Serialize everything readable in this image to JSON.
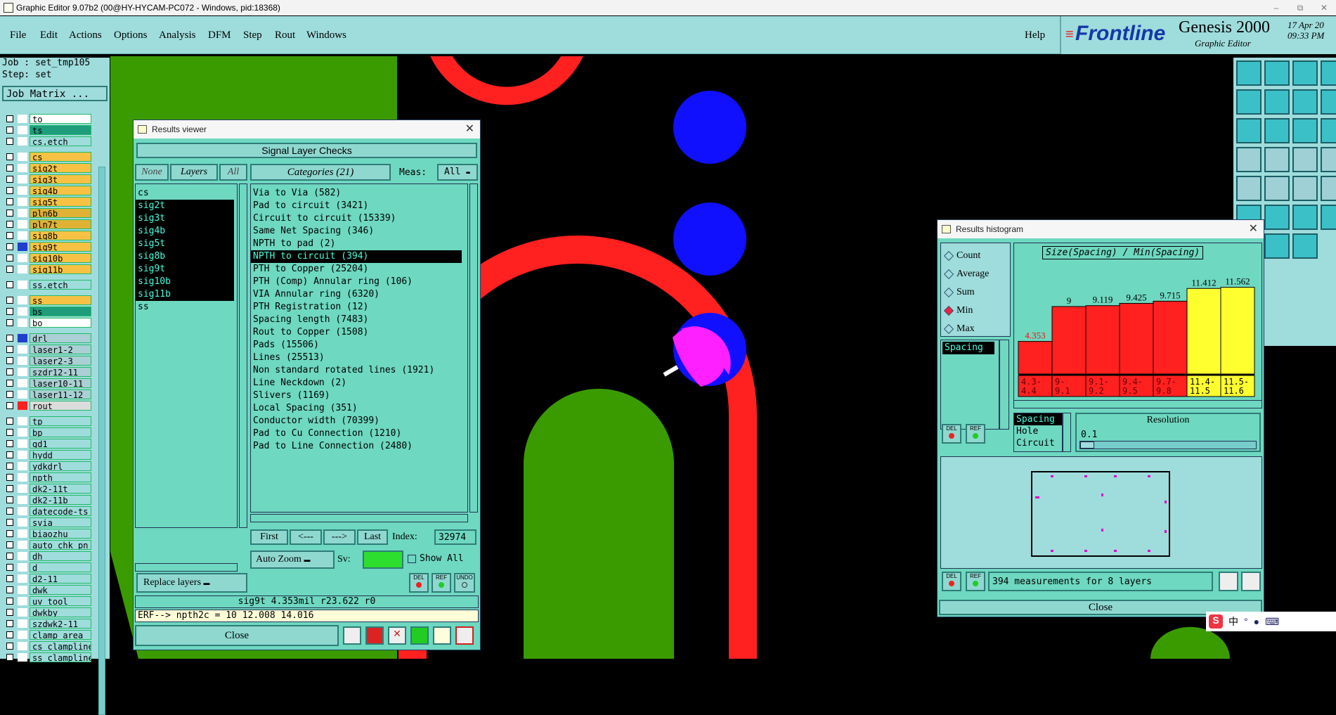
{
  "window": {
    "title": "Graphic Editor 9.07b2 (00@HY-HYCAM-PC072 - Windows, pid:18368)",
    "controls": [
      "–",
      "⧉",
      "✕"
    ]
  },
  "menu": {
    "items": [
      "File",
      "Edit",
      "Actions",
      "Options",
      "Analysis",
      "DFM",
      "Step",
      "Rout",
      "Windows"
    ],
    "help": "Help"
  },
  "logo": {
    "brand": "Frontline",
    "product": "Genesis 2000",
    "sub": "Graphic Editor",
    "date": "17 Apr 20",
    "time": "09:33 PM"
  },
  "job": {
    "job": "Job : set_tmp105",
    "step": "Step: set",
    "matrix": "Job Matrix ..."
  },
  "layers": [
    {
      "name": "to",
      "color": "#ffffff",
      "box": "#ffffff"
    },
    {
      "name": "ts",
      "color": "#1e9c7c",
      "box": "#ffffff"
    },
    {
      "name": "cs.etch",
      "color": "#9fdcdc",
      "box": "#ffffff"
    },
    {
      "name": "cs",
      "color": "#f7c244",
      "box": "#ffffff"
    },
    {
      "name": "sig2t",
      "color": "#f7c244",
      "box": "#ffffff"
    },
    {
      "name": "sig3t",
      "color": "#f7c244",
      "box": "#ffffff"
    },
    {
      "name": "sig4b",
      "color": "#f7c244",
      "box": "#ffffff"
    },
    {
      "name": "sig5t",
      "color": "#f7c244",
      "box": "#ffffff"
    },
    {
      "name": "pln6b",
      "color": "#dfb235",
      "box": "#ffffff"
    },
    {
      "name": "pln7t",
      "color": "#dfb235",
      "box": "#ffffff"
    },
    {
      "name": "sig8b",
      "color": "#f7c244",
      "box": "#ffffff"
    },
    {
      "name": "sig9t",
      "color": "#f7c244",
      "box": "#1f3fcc"
    },
    {
      "name": "sig10b",
      "color": "#f7c244",
      "box": "#ffffff"
    },
    {
      "name": "sig11b",
      "color": "#f7c244",
      "box": "#ffffff"
    },
    {
      "name": "ss.etch",
      "color": "#9fdcdc",
      "box": "#ffffff"
    },
    {
      "name": "ss",
      "color": "#f7c244",
      "box": "#ffffff"
    },
    {
      "name": "bs",
      "color": "#1e9c7c",
      "box": "#ffffff"
    },
    {
      "name": "bo",
      "color": "#ffffff",
      "box": "#ffffff"
    },
    {
      "name": "drl",
      "color": "#aacfd4",
      "box": "#1f3fcc"
    },
    {
      "name": "laser1-2",
      "color": "#aacfd4",
      "box": "#ffffff"
    },
    {
      "name": "laser2-3",
      "color": "#aacfd4",
      "box": "#ffffff"
    },
    {
      "name": "szdr12-11",
      "color": "#aacfd4",
      "box": "#ffffff"
    },
    {
      "name": "laser10-11",
      "color": "#aacfd4",
      "box": "#ffffff"
    },
    {
      "name": "laser11-12",
      "color": "#aacfd4",
      "box": "#ffffff"
    },
    {
      "name": "rout",
      "color": "#dcdcdc",
      "box": "#ff2020"
    },
    {
      "name": "tp",
      "color": "#9fdcdc",
      "box": "#ffffff"
    },
    {
      "name": "bp",
      "color": "#9fdcdc",
      "box": "#ffffff"
    },
    {
      "name": "gd1",
      "color": "#9fdcdc",
      "box": "#ffffff"
    },
    {
      "name": "hydd",
      "color": "#9fdcdc",
      "box": "#ffffff"
    },
    {
      "name": "ydkdrl",
      "color": "#9fdcdc",
      "box": "#ffffff"
    },
    {
      "name": "npth",
      "color": "#9fdcdc",
      "box": "#ffffff"
    },
    {
      "name": "dk2-11t",
      "color": "#9fdcdc",
      "box": "#ffffff"
    },
    {
      "name": "dk2-11b",
      "color": "#9fdcdc",
      "box": "#ffffff"
    },
    {
      "name": "datecode-ts",
      "color": "#9fdcdc",
      "box": "#ffffff"
    },
    {
      "name": "svia",
      "color": "#9fdcdc",
      "box": "#ffffff"
    },
    {
      "name": "biaozhu",
      "color": "#9fdcdc",
      "box": "#ffffff"
    },
    {
      "name": "auto_chk_pn",
      "color": "#9fdcdc",
      "box": "#ffffff"
    },
    {
      "name": "dh",
      "color": "#9fdcdc",
      "box": "#ffffff"
    },
    {
      "name": "d",
      "color": "#9fdcdc",
      "box": "#ffffff"
    },
    {
      "name": "d2-11",
      "color": "#9fdcdc",
      "box": "#ffffff"
    },
    {
      "name": "dwk",
      "color": "#9fdcdc",
      "box": "#ffffff"
    },
    {
      "name": "uv_tool",
      "color": "#9fdcdc",
      "box": "#ffffff"
    },
    {
      "name": "dwkby",
      "color": "#9fdcdc",
      "box": "#ffffff"
    },
    {
      "name": "szdwk2-11",
      "color": "#9fdcdc",
      "box": "#ffffff"
    },
    {
      "name": "clamp_area",
      "color": "#9fdcdc",
      "box": "#ffffff"
    },
    {
      "name": "cs_clampline",
      "color": "#9fdcdc",
      "box": "#ffffff"
    },
    {
      "name": "ss_clampline",
      "color": "#9fdcdc",
      "box": "#ffffff"
    }
  ],
  "results_viewer": {
    "title": "Results viewer",
    "header": "Signal Layer Checks",
    "none": "None",
    "layers_label": "Layers",
    "all": "All",
    "layer_list": [
      "cs",
      "sig2t",
      "sig3t",
      "sig4b",
      "sig5t",
      "sig8b",
      "sig9t",
      "sig10b",
      "sig11b",
      "ss"
    ],
    "selected_layers": [
      "sig2t",
      "sig3t",
      "sig4b",
      "sig5t",
      "sig8b",
      "sig9t",
      "sig10b",
      "sig11b"
    ],
    "categories_label": "Categories (21)",
    "meas_label": "Meas:",
    "meas_value": "All",
    "categories": [
      "Via to Via (582)",
      "Pad to circuit (3421)",
      "Circuit to circuit (15339)",
      "Same Net Spacing (346)",
      "NPTH to pad (2)",
      "NPTH to circuit (394)",
      "PTH to Copper (25204)",
      "PTH (Comp) Annular ring (106)",
      "VIA Annular ring (6320)",
      "PTH Registration (12)",
      "Spacing length (7483)",
      "Rout to Copper (1508)",
      "Pads (15506)",
      "Lines (25513)",
      "Non standard rotated lines (1921)",
      "Line Neckdown (2)",
      "Slivers (1169)",
      "Local Spacing (351)",
      "Conductor width (70399)",
      "Pad to Cu Connection (1210)",
      "Pad to Line Connection (2480)"
    ],
    "selected_category": "NPTH to circuit (394)",
    "first": "First",
    "prev": "<---",
    "next": "--->",
    "last": "Last",
    "index_label": "Index:",
    "index_value": "32974",
    "auto_zoom": "Auto Zoom",
    "sv": "Sv:",
    "show_all": "Show All",
    "replace_layers": "Replace layers",
    "del": "DEL",
    "ref": "REF",
    "undo": "UNDO",
    "info": "sig9t  4.353mil  r23.622  r0",
    "erf": "ERF--> npth2c = 10 12.008 14.016",
    "close": "Close"
  },
  "histogram": {
    "title": "Results histogram",
    "modes": [
      "Count",
      "Average",
      "Sum",
      "Min",
      "Max"
    ],
    "selected_mode": "Min",
    "list_item": "Spacing",
    "chart_title": "Size(Spacing) / Min(Spacing)",
    "types": [
      "Spacing",
      "Hole",
      "Circuit"
    ],
    "selected_type": "Spacing",
    "resolution_label": "Resolution",
    "resolution_value": "0.1",
    "status": "394 measurements for 8 layers",
    "close": "Close",
    "del": "DEL",
    "ref": "REF"
  },
  "chart_data": {
    "type": "bar",
    "title": "Size(Spacing) / Min(Spacing)",
    "categories": [
      "4.3-4.4",
      "9-9.1",
      "9.1-9.2",
      "9.4-9.5",
      "9.7-9.8",
      "11.4-11.5",
      "11.5-11.6"
    ],
    "values": [
      4.353,
      9,
      9.119,
      9.425,
      9.715,
      11.412,
      11.562
    ],
    "value_labels": [
      "4.353",
      "9",
      "9.119",
      "9.425",
      "9.715",
      "11.412",
      "11.562"
    ],
    "colors": [
      "#ff2020",
      "#ff2020",
      "#ff2020",
      "#ff2020",
      "#ff2020",
      "#ffff30",
      "#ffff30"
    ],
    "ylim": [
      0,
      12
    ]
  },
  "ime": {
    "label": "中"
  }
}
